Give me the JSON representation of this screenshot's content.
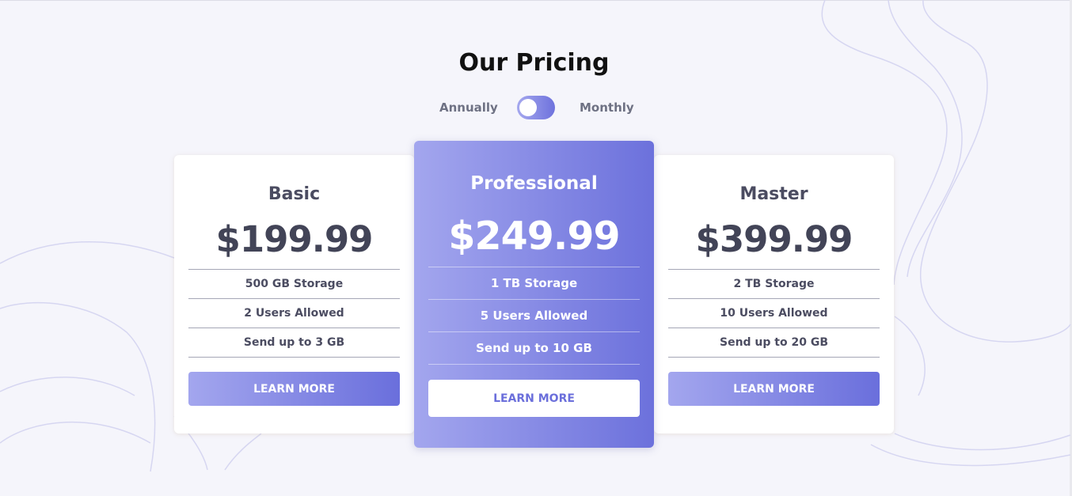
{
  "page": {
    "title": "Our Pricing"
  },
  "billing_toggle": {
    "left_label": "Annually",
    "right_label": "Monthly",
    "state": "annually"
  },
  "plans": [
    {
      "name": "Basic",
      "price": "$199.99",
      "features": [
        "500 GB Storage",
        "2 Users Allowed",
        "Send up to 3 GB"
      ],
      "button_label": "LEARN MORE"
    },
    {
      "name": "Professional",
      "price": "$249.99",
      "features": [
        "1 TB Storage",
        "5 Users Allowed",
        "Send up to 10 GB"
      ],
      "button_label": "LEARN MORE",
      "highlighted": true
    },
    {
      "name": "Master",
      "price": "$399.99",
      "features": [
        "2 TB Storage",
        "10 Users Allowed",
        "Send up to 20 GB"
      ],
      "button_label": "LEARN MORE"
    }
  ],
  "colors": {
    "background": "#f5f5fb",
    "accent_gradient_start": "#a3a6ee",
    "accent_gradient_end": "#6c71dc",
    "heading_text": "#111111",
    "body_text": "#4b4c61",
    "decorative_lines": "#d6d6f1"
  }
}
